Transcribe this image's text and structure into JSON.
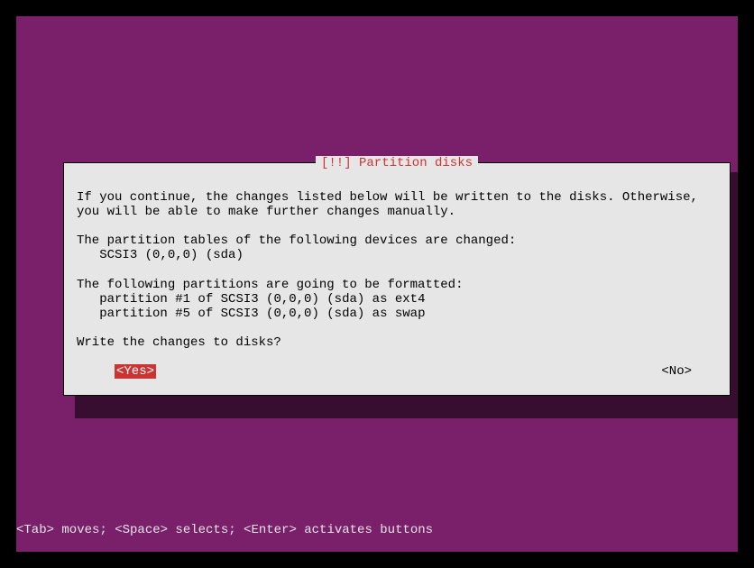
{
  "dialog": {
    "title": "[!!] Partition disks",
    "intro": "If you continue, the changes listed below will be written to the disks. Otherwise, you will be able to make further changes manually.",
    "tables_heading": "The partition tables of the following devices are changed:",
    "tables_items": [
      "SCSI3 (0,0,0) (sda)"
    ],
    "format_heading": "The following partitions are going to be formatted:",
    "format_items": [
      "partition #1 of SCSI3 (0,0,0) (sda) as ext4",
      "partition #5 of SCSI3 (0,0,0) (sda) as swap"
    ],
    "question": "Write the changes to disks?",
    "yes_label": "<Yes>",
    "no_label": "<No>",
    "selected": "yes"
  },
  "hint": "<Tab> moves; <Space> selects; <Enter> activates buttons"
}
